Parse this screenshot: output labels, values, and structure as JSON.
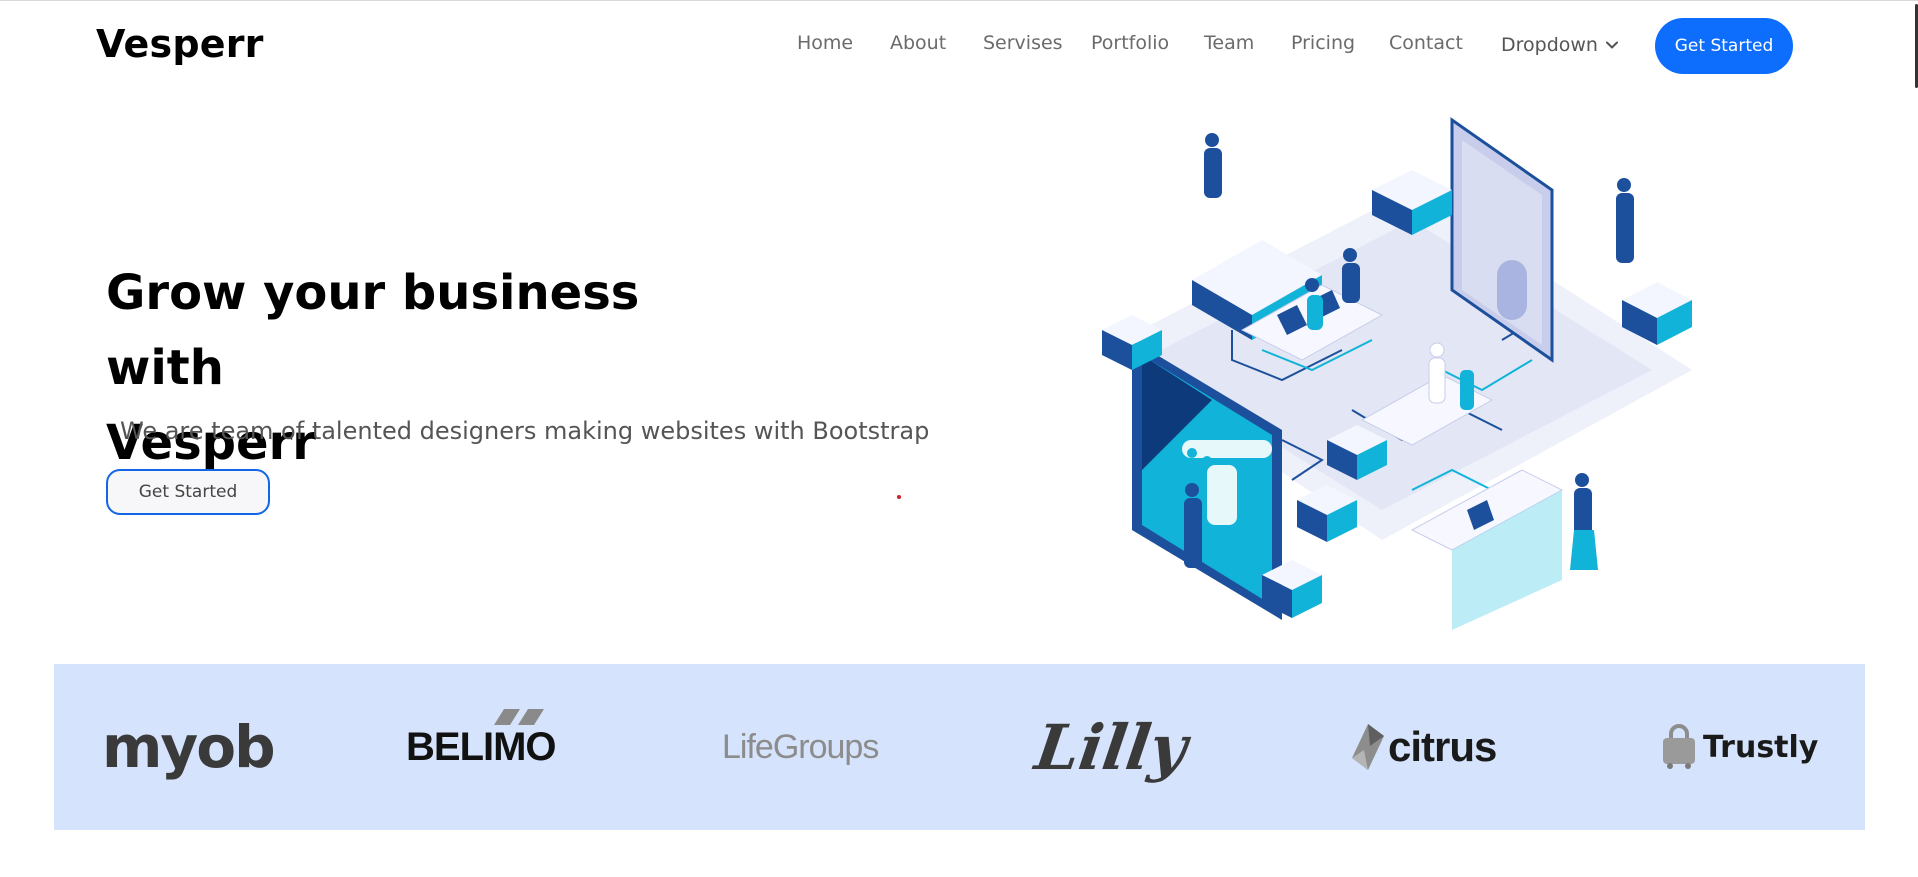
{
  "header": {
    "brand": "Vesperr",
    "nav": [
      {
        "label": "Home"
      },
      {
        "label": "About"
      },
      {
        "label": "Servises"
      },
      {
        "label": "Portfolio"
      },
      {
        "label": "Team"
      },
      {
        "label": "Pricing"
      },
      {
        "label": "Contact"
      },
      {
        "label": "Dropdown"
      }
    ],
    "cta_label": "Get Started"
  },
  "hero": {
    "title_line1": "Grow your business with",
    "title_line2": "Vesperr",
    "subtitle": "We are team of talented designers making websites with Bootstrap",
    "button_label": "Get Started"
  },
  "clients": [
    {
      "name": "myob"
    },
    {
      "name": "BELIMO"
    },
    {
      "name": "LifeGroups"
    },
    {
      "name": "Lilly"
    },
    {
      "name": "citrus"
    },
    {
      "name": "Trustly"
    }
  ],
  "colors": {
    "accent": "#0d6efd",
    "clients_bg": "#d5e4fc",
    "illustration_blue": "#1c4f9c",
    "illustration_cyan": "#12b3d8"
  },
  "icons": {
    "dropdown": "chevron-down-icon",
    "illustration": "isometric-office-illustration"
  }
}
